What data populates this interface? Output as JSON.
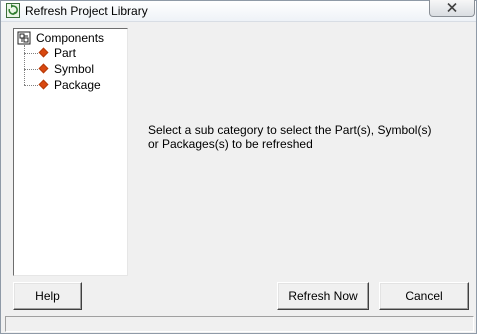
{
  "window": {
    "title": "Refresh Project Library"
  },
  "tree": {
    "root_label": "Components",
    "items": [
      {
        "label": "Part"
      },
      {
        "label": "Symbol"
      },
      {
        "label": "Package"
      }
    ]
  },
  "message": "Select a sub category to select the Part(s), Symbol(s) or Packages(s) to be refreshed",
  "buttons": {
    "help_mnemonic": "H",
    "help_rest": "elp",
    "refresh_mnemonic": "R",
    "refresh_rest": "efresh Now",
    "cancel_mnemonic": "C",
    "cancel_rest": "ancel"
  },
  "colors": {
    "item_marker": "#d9480f",
    "title_icon": "#3a6e3a"
  }
}
